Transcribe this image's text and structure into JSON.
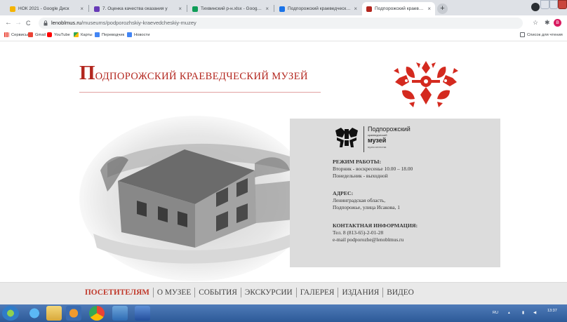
{
  "browser": {
    "tabs": [
      {
        "label": "НОК 2021 - Google Диск",
        "color": "#f5b400"
      },
      {
        "label": "7. Оценка качества оказания у",
        "color": "#673ab7"
      },
      {
        "label": "Тихвинский р-н.xlsx - Google Т",
        "color": "#0f9d58"
      },
      {
        "label": "Подпорожский краеведческий",
        "color": "#1a73e8"
      },
      {
        "label": "Подпорожский краеведческий",
        "color": "#b3261e"
      }
    ],
    "close_glyph": "×",
    "new_tab_glyph": "+",
    "url_host": "lenoblmus.ru",
    "url_path": "/museums/podporozhskiy-kraevedcheskiy-muzey",
    "nav": {
      "back": "←",
      "forward": "→",
      "reload": "C"
    },
    "bookmarks": [
      {
        "label": "Сервисы",
        "color": "#ea4335"
      },
      {
        "label": "Gmail",
        "color": "#ea4335"
      },
      {
        "label": "YouTube",
        "color": "#ff0000"
      },
      {
        "label": "Карты",
        "color": "#34a853"
      },
      {
        "label": "Переводчик",
        "color": "#4285f4"
      },
      {
        "label": "Новости",
        "color": "#4285f4"
      }
    ],
    "reading_list": "Список для чтения",
    "profile_initial": "B"
  },
  "page": {
    "title_cap": "П",
    "title_rest": "ОДПОРОЖСКИЙ КРАЕВЕДЧЕСКИЙ МУЗЕЙ",
    "accent_color": "#b3261e",
    "logo": {
      "line1": "Подпорожский",
      "line2": "краеведческий",
      "line3": "музей",
      "line4": "музеи агентства"
    },
    "info": {
      "hours_title": "РЕЖИМ РАБОТЫ:",
      "hours_line1": "Вторник - воскресенье 10.00 – 18.00",
      "hours_line2": "Понедельник - выходной",
      "address_title": "АДРЕС:",
      "address_line1": "Ленинградская область,",
      "address_line2": "Подпорожье, улица Исакова, 1",
      "contact_title": "КОНТАКТНАЯ ИНФОРМАЦИЯ:",
      "phone": "Тел. 8 (813-65)-2-01-28",
      "email": "e-mail podporozhe@lenoblmus.ru"
    },
    "menu": [
      {
        "label": "ПОСЕТИТЕЛЯМ",
        "active": true
      },
      {
        "label": "О МУЗЕЕ",
        "active": false
      },
      {
        "label": "СОБЫТИЯ",
        "active": false
      },
      {
        "label": "ЭКСКУРСИИ",
        "active": false
      },
      {
        "label": "ГАЛЕРЕЯ",
        "active": false
      },
      {
        "label": "ИЗДАНИЯ",
        "active": false
      },
      {
        "label": "ВИДЕО",
        "active": false
      }
    ]
  },
  "taskbar": {
    "language": "RU",
    "time": "13:37"
  }
}
